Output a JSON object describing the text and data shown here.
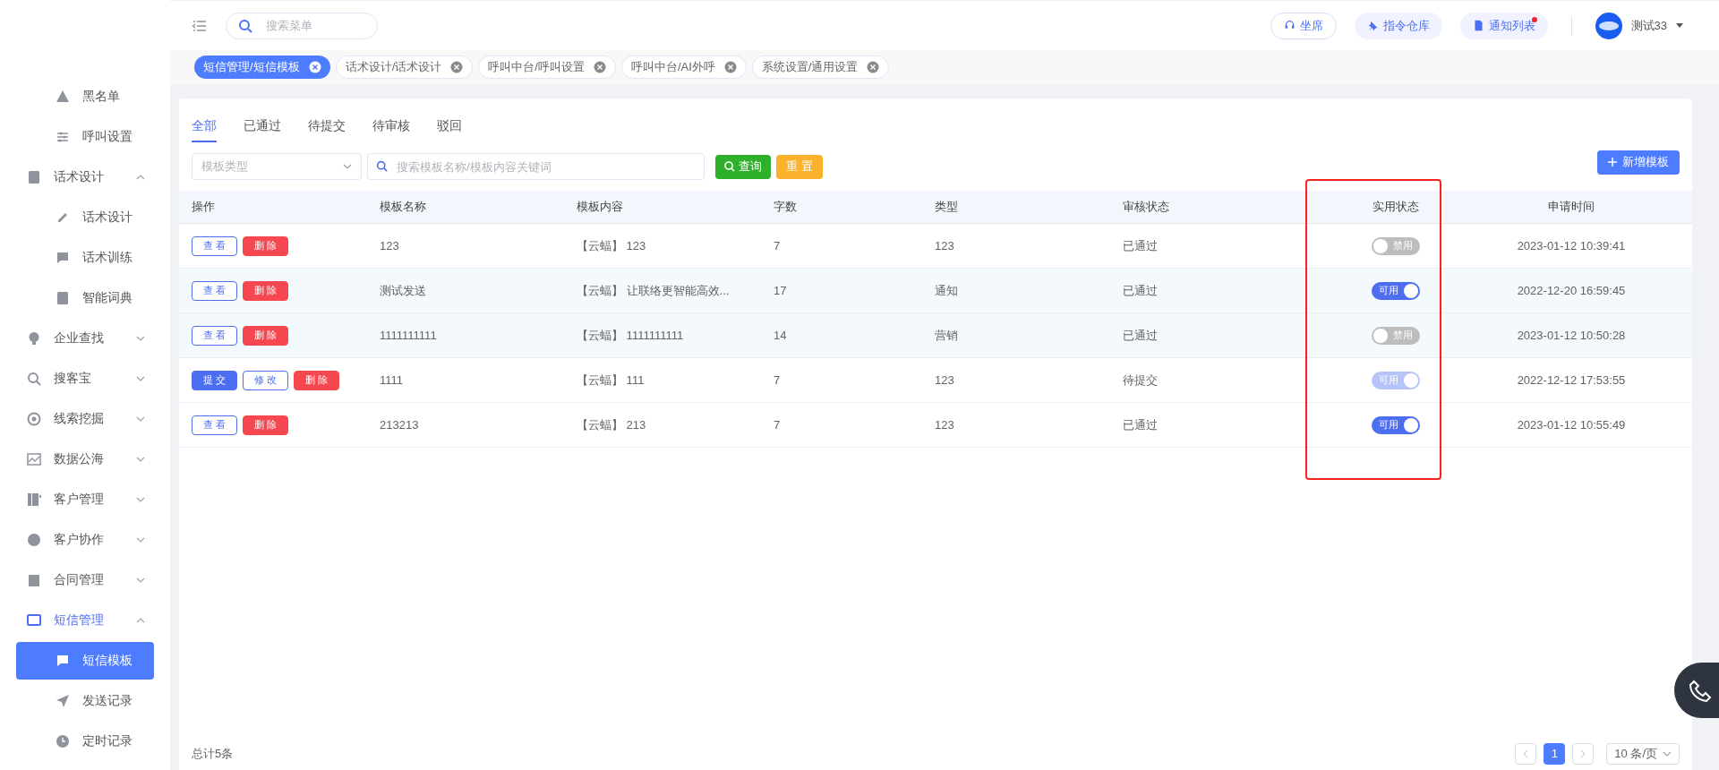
{
  "sidebar": {
    "items": [
      {
        "label": "黑名单",
        "kind": "link",
        "selected": false
      },
      {
        "label": "呼叫设置",
        "kind": "link",
        "selected": false
      },
      {
        "label": "话术设计",
        "kind": "group",
        "selected": false,
        "expanded": true,
        "children": [
          {
            "label": "话术设计",
            "kind": "link",
            "selected": false
          },
          {
            "label": "话术训练",
            "kind": "link",
            "selected": false
          },
          {
            "label": "智能词典",
            "kind": "link",
            "selected": false
          }
        ]
      },
      {
        "label": "企业查找",
        "kind": "group",
        "selected": false,
        "expanded": false
      },
      {
        "label": "搜客宝",
        "kind": "group",
        "selected": false,
        "expanded": false
      },
      {
        "label": "线索挖掘",
        "kind": "group",
        "selected": false,
        "expanded": false
      },
      {
        "label": "数据公海",
        "kind": "group",
        "selected": false,
        "expanded": false
      },
      {
        "label": "客户管理",
        "kind": "group",
        "selected": false,
        "expanded": false
      },
      {
        "label": "客户协作",
        "kind": "group",
        "selected": false,
        "expanded": false
      },
      {
        "label": "合同管理",
        "kind": "group",
        "selected": false,
        "expanded": false
      },
      {
        "label": "短信管理",
        "kind": "group",
        "selected": false,
        "expanded": true,
        "children": [
          {
            "label": "短信模板",
            "kind": "link",
            "selected": true
          },
          {
            "label": "发送记录",
            "kind": "link",
            "selected": false
          },
          {
            "label": "定时记录",
            "kind": "link",
            "selected": false
          }
        ]
      }
    ]
  },
  "header": {
    "search_placeholder": "搜索菜单",
    "buttons": [
      {
        "label": "坐席",
        "outlined": true,
        "dot": false
      },
      {
        "label": "指令仓库",
        "outlined": false,
        "dot": false
      },
      {
        "label": "通知列表",
        "outlined": false,
        "dot": true
      }
    ],
    "user": "测试33"
  },
  "open_tabs": [
    {
      "label": "短信管理/短信模板",
      "selected": true
    },
    {
      "label": "话术设计/话术设计",
      "selected": false
    },
    {
      "label": "呼叫中台/呼叫设置",
      "selected": false
    },
    {
      "label": "呼叫中台/AI外呼",
      "selected": false
    },
    {
      "label": "系统设置/通用设置",
      "selected": false
    }
  ],
  "filter_tabs": [
    {
      "label": "全部",
      "selected": true
    },
    {
      "label": "已通过",
      "selected": false
    },
    {
      "label": "待提交",
      "selected": false
    },
    {
      "label": "待审核",
      "selected": false
    },
    {
      "label": "驳回",
      "selected": false
    }
  ],
  "filters": {
    "type_placeholder": "模板类型",
    "search_placeholder": "搜索模板名称/模板内容关键词",
    "query_button": "查询",
    "reset_button": "重 置",
    "add_button": "新增模板"
  },
  "table": {
    "columns": [
      "操作",
      "模板名称",
      "模板内容",
      "字数",
      "类型",
      "审核状态",
      "实用状态",
      "申请时间"
    ],
    "rows": [
      {
        "highlighted": false,
        "actions": [
          {
            "label": "查 看",
            "kind": "outline"
          },
          {
            "label": "删 除",
            "kind": "danger"
          }
        ],
        "name": "123",
        "content": "【云蝠】 123",
        "chars": "7",
        "type": "123",
        "review": "已通过",
        "switch": {
          "label": "禁用",
          "on": false,
          "disabled": false
        },
        "time": "2023-01-12 10:39:41"
      },
      {
        "highlighted": true,
        "actions": [
          {
            "label": "查 看",
            "kind": "outline"
          },
          {
            "label": "删 除",
            "kind": "danger"
          }
        ],
        "name": "测试发送",
        "content": "【云蝠】 让联络更智能高效...",
        "chars": "17",
        "type": "通知",
        "review": "已通过",
        "switch": {
          "label": "可用",
          "on": true,
          "disabled": false
        },
        "time": "2022-12-20 16:59:45"
      },
      {
        "highlighted": true,
        "actions": [
          {
            "label": "查 看",
            "kind": "outline"
          },
          {
            "label": "删 除",
            "kind": "danger"
          }
        ],
        "name": "1111111111",
        "content": "【云蝠】 1111111111",
        "chars": "14",
        "type": "营销",
        "review": "已通过",
        "switch": {
          "label": "禁用",
          "on": false,
          "disabled": false
        },
        "time": "2023-01-12 10:50:28"
      },
      {
        "highlighted": false,
        "actions": [
          {
            "label": "提 交",
            "kind": "primary"
          },
          {
            "label": "修 改",
            "kind": "outline"
          },
          {
            "label": "删 除",
            "kind": "danger"
          }
        ],
        "name": "1111",
        "content": "【云蝠】 111",
        "chars": "7",
        "type": "123",
        "review": "待提交",
        "switch": {
          "label": "可用",
          "on": true,
          "disabled": true
        },
        "time": "2022-12-12 17:53:55"
      },
      {
        "highlighted": false,
        "actions": [
          {
            "label": "查 看",
            "kind": "outline"
          },
          {
            "label": "删 除",
            "kind": "danger"
          }
        ],
        "name": "213213",
        "content": "【云蝠】 213",
        "chars": "7",
        "type": "123",
        "review": "已通过",
        "switch": {
          "label": "可用",
          "on": true,
          "disabled": false
        },
        "time": "2023-01-12 10:55:49"
      }
    ]
  },
  "footer": {
    "total": "总计5条",
    "pages": [
      {
        "label": "1",
        "selected": true
      }
    ],
    "page_size": "10 条/页"
  }
}
